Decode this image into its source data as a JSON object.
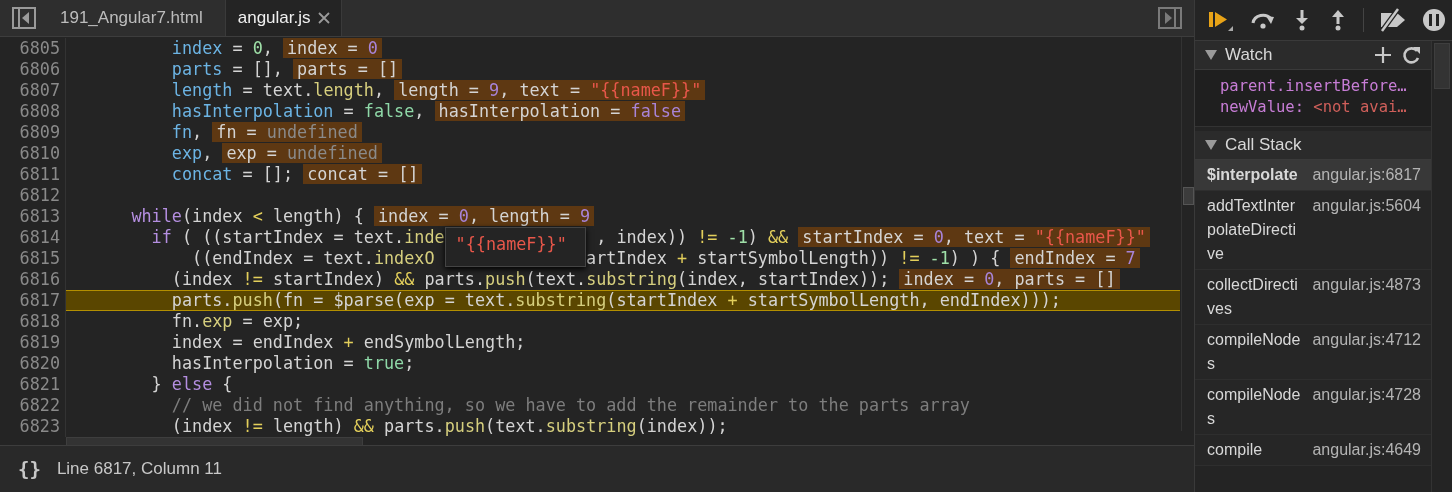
{
  "editor": {
    "tabs": [
      {
        "label": "191_Angular7.html",
        "selected": false,
        "closable": false
      },
      {
        "label": "angular.js",
        "selected": true,
        "closable": true
      }
    ],
    "code": {
      "lines": [
        {
          "number": "6805",
          "current": false,
          "segments": [
            [
              {
                "kind": "variable",
                "text": "        index"
              },
              {
                "kind": "plain",
                "text": " = "
              },
              {
                "kind": "number",
                "text": "0"
              },
              {
                "kind": "plain",
                "text": ","
              }
            ]
          ],
          "values": [
            {
              "kind": "plain",
              "text": "index = "
            },
            {
              "kind": "value",
              "text": "0"
            }
          ]
        },
        {
          "number": "6806",
          "current": false,
          "segments": [
            [
              {
                "kind": "variable",
                "text": "        parts"
              },
              {
                "kind": "plain",
                "text": " = [],"
              }
            ]
          ],
          "values": [
            {
              "kind": "plain",
              "text": "parts = []"
            }
          ]
        },
        {
          "number": "6807",
          "current": false,
          "segments": [
            [
              {
                "kind": "variable",
                "text": "        length"
              },
              {
                "kind": "plain",
                "text": " = text."
              },
              {
                "kind": "method",
                "text": "length"
              },
              {
                "kind": "plain",
                "text": ","
              }
            ]
          ],
          "values": [
            {
              "kind": "plain",
              "text": "length = "
            },
            {
              "kind": "value",
              "text": "9"
            },
            {
              "kind": "plain",
              "text": ", text = "
            },
            {
              "kind": "string",
              "text": "\"{{nameF}}\""
            }
          ]
        },
        {
          "number": "6808",
          "current": false,
          "segments": [
            [
              {
                "kind": "variable",
                "text": "        hasInterpolation"
              },
              {
                "kind": "plain",
                "text": " = "
              },
              {
                "kind": "boolean",
                "text": "false"
              },
              {
                "kind": "plain",
                "text": ","
              }
            ]
          ],
          "values": [
            {
              "kind": "plain",
              "text": "hasInterpolation = "
            },
            {
              "kind": "value",
              "text": "false"
            }
          ]
        },
        {
          "number": "6809",
          "current": false,
          "segments": [
            [
              {
                "kind": "variable",
                "text": "        fn"
              },
              {
                "kind": "plain",
                "text": ","
              }
            ]
          ],
          "values": [
            {
              "kind": "plain",
              "text": "fn = "
            },
            {
              "kind": "undefined",
              "text": "undefined"
            }
          ]
        },
        {
          "number": "6810",
          "current": false,
          "segments": [
            [
              {
                "kind": "variable",
                "text": "        exp"
              },
              {
                "kind": "plain",
                "text": ","
              }
            ]
          ],
          "values": [
            {
              "kind": "plain",
              "text": "exp = "
            },
            {
              "kind": "undefined",
              "text": "undefined"
            }
          ]
        },
        {
          "number": "6811",
          "current": false,
          "segments": [
            [
              {
                "kind": "variable",
                "text": "        concat"
              },
              {
                "kind": "plain",
                "text": " = [];"
              }
            ]
          ],
          "values": [
            {
              "kind": "plain",
              "text": "concat = []"
            }
          ]
        },
        {
          "number": "6812",
          "current": false
        },
        {
          "number": "6813",
          "current": false,
          "segments": [
            [
              {
                "kind": "keyword",
                "text": "    while"
              },
              {
                "kind": "plain",
                "text": "(index "
              },
              {
                "kind": "operator",
                "text": "<"
              },
              {
                "kind": "plain",
                "text": " length) {"
              }
            ]
          ],
          "values": [
            {
              "kind": "plain",
              "text": "index = "
            },
            {
              "kind": "value",
              "text": "0"
            },
            {
              "kind": "plain",
              "text": ", length = "
            },
            {
              "kind": "value",
              "text": "9"
            }
          ]
        },
        {
          "number": "6814",
          "current": false,
          "segments": [
            [
              {
                "kind": "keyword",
                "text": "      if"
              },
              {
                "kind": "plain",
                "text": " ( ((startIndex = text."
              },
              {
                "kind": "method",
                "text": "inde"
              }
            ],
            [
              {
                "kind": "plain",
                "text": ", index)) "
              },
              {
                "kind": "operator",
                "text": "!="
              },
              {
                "kind": "number",
                "text": " -1"
              },
              {
                "kind": "plain",
                "text": ") "
              },
              {
                "kind": "operator",
                "text": "&&"
              }
            ]
          ],
          "values": [
            {
              "kind": "plain",
              "text": "startIndex = "
            },
            {
              "kind": "value",
              "text": "0"
            },
            {
              "kind": "plain",
              "text": ", text = "
            },
            {
              "kind": "string",
              "text": "\"{{nameF}}\""
            }
          ]
        },
        {
          "number": "6815",
          "current": false,
          "segments": [
            [
              {
                "kind": "plain",
                "text": "          ((endIndex = text."
              },
              {
                "kind": "method",
                "text": "indexO"
              }
            ],
            [
              {
                "kind": "plain",
                "text": "artIndex "
              },
              {
                "kind": "operator",
                "text": "+"
              },
              {
                "kind": "plain",
                "text": " startSymbolLength)) "
              },
              {
                "kind": "operator",
                "text": "!="
              },
              {
                "kind": "number",
                "text": " -1"
              },
              {
                "kind": "plain",
                "text": ") ) {"
              }
            ]
          ],
          "values": [
            {
              "kind": "plain",
              "text": "endIndex = "
            },
            {
              "kind": "value",
              "text": "7"
            }
          ]
        },
        {
          "number": "6816",
          "current": false,
          "segments": [
            [
              {
                "kind": "plain",
                "text": "        (index "
              },
              {
                "kind": "operator",
                "text": "!="
              },
              {
                "kind": "plain",
                "text": " startIndex) "
              },
              {
                "kind": "operator",
                "text": "&&"
              },
              {
                "kind": "plain",
                "text": " parts."
              },
              {
                "kind": "method",
                "text": "push"
              },
              {
                "kind": "plain",
                "text": "(text."
              },
              {
                "kind": "method",
                "text": "substring"
              },
              {
                "kind": "plain",
                "text": "(index, startIndex));"
              }
            ]
          ],
          "values": [
            {
              "kind": "plain",
              "text": "index = "
            },
            {
              "kind": "value",
              "text": "0"
            },
            {
              "kind": "plain",
              "text": ", parts = []"
            }
          ]
        },
        {
          "number": "6817",
          "current": true,
          "segments": [
            [
              {
                "kind": "plain",
                "text": "        parts."
              },
              {
                "kind": "method",
                "text": "push"
              },
              {
                "kind": "plain",
                "text": "(fn = $parse(exp = text."
              },
              {
                "kind": "method",
                "text": "substring"
              },
              {
                "kind": "plain",
                "text": "(startIndex "
              },
              {
                "kind": "operator",
                "text": "+"
              },
              {
                "kind": "plain",
                "text": " startSymbolLength, endIndex)));"
              }
            ]
          ]
        },
        {
          "number": "6818",
          "current": false,
          "segments": [
            [
              {
                "kind": "plain",
                "text": "        fn."
              },
              {
                "kind": "method",
                "text": "exp"
              },
              {
                "kind": "plain",
                "text": " = exp;"
              }
            ]
          ]
        },
        {
          "number": "6819",
          "current": false,
          "segments": [
            [
              {
                "kind": "plain",
                "text": "        index = endIndex "
              },
              {
                "kind": "operator",
                "text": "+"
              },
              {
                "kind": "plain",
                "text": " endSymbolLength;"
              }
            ]
          ]
        },
        {
          "number": "6820",
          "current": false,
          "segments": [
            [
              {
                "kind": "plain",
                "text": "        hasInterpolation = "
              },
              {
                "kind": "boolean",
                "text": "true"
              },
              {
                "kind": "plain",
                "text": ";"
              }
            ]
          ]
        },
        {
          "number": "6821",
          "current": false,
          "segments": [
            [
              {
                "kind": "plain",
                "text": "      } "
              },
              {
                "kind": "keyword",
                "text": "else"
              },
              {
                "kind": "plain",
                "text": " {"
              }
            ]
          ]
        },
        {
          "number": "6822",
          "current": false,
          "segments": [
            [
              {
                "kind": "comment",
                "text": "        // we did not find anything, so we have to add the remainder to the parts array"
              }
            ]
          ]
        },
        {
          "number": "6823",
          "current": false,
          "segments": [
            [
              {
                "kind": "plain",
                "text": "        (index "
              },
              {
                "kind": "operator",
                "text": "!="
              },
              {
                "kind": "plain",
                "text": " length) "
              },
              {
                "kind": "operator",
                "text": "&&"
              },
              {
                "kind": "plain",
                "text": " parts."
              },
              {
                "kind": "method",
                "text": "push"
              },
              {
                "kind": "plain",
                "text": "(text."
              },
              {
                "kind": "method",
                "text": "substring"
              },
              {
                "kind": "plain",
                "text": "(index));"
              }
            ]
          ]
        }
      ],
      "tooltip": {
        "text": "\"{{nameF}}\""
      }
    },
    "status": {
      "format_label": "{}",
      "position": "Line 6817, Column 11"
    }
  },
  "debugger": {
    "watch": {
      "title": "Watch",
      "expanded": true,
      "expressions": [
        {
          "label": "parent.insertBefore…"
        },
        {
          "label": "newValue:",
          "value": "<not avai…"
        }
      ]
    },
    "call_stack": {
      "title": "Call Stack",
      "expanded": true,
      "frames": [
        {
          "function": "$interpolate",
          "location": "angular.js:6817",
          "selected": true
        },
        {
          "function": "addTextInterpolateDirective",
          "location": "angular.js:5604",
          "selected": false
        },
        {
          "function": "collectDirectives",
          "location": "angular.js:4873",
          "selected": false
        },
        {
          "function": "compileNodes",
          "location": "angular.js:4712",
          "selected": false
        },
        {
          "function": "compileNodes",
          "location": "angular.js:4728",
          "selected": false
        },
        {
          "function": "compile",
          "location": "angular.js:4649",
          "selected": false
        }
      ]
    }
  }
}
